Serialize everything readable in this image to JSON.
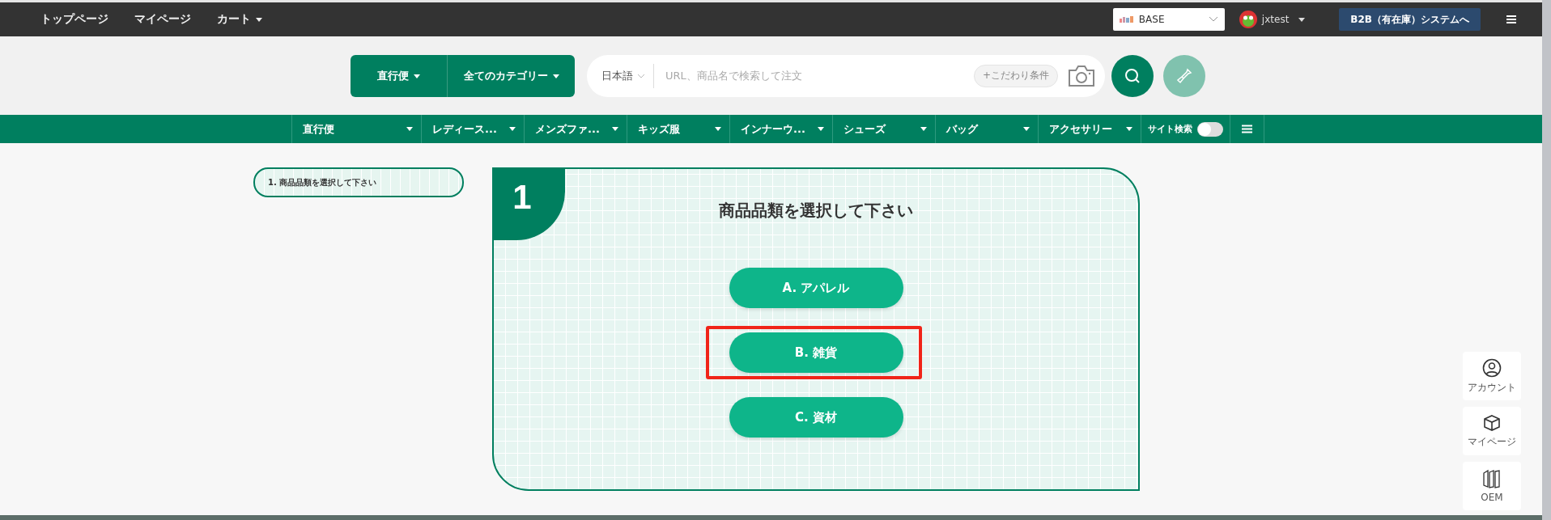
{
  "top_nav": {
    "links": [
      {
        "label": "トップページ",
        "dropdown": false
      },
      {
        "label": "マイページ",
        "dropdown": false
      },
      {
        "label": "カート",
        "dropdown": true
      }
    ],
    "store_select": {
      "value": "BASE"
    },
    "user": {
      "name": "jxtest"
    },
    "system_button": "B2B（有在庫）システムへ"
  },
  "search_bar": {
    "shipping": "直行便",
    "category": "全てのカテゴリー",
    "language": "日本語",
    "placeholder": "URL、商品名で検索して注文",
    "filter": "+こだわり条件"
  },
  "category_nav": {
    "items": [
      {
        "label": "直行便"
      },
      {
        "label": "レディース..."
      },
      {
        "label": "メンズファ..."
      },
      {
        "label": "キッズ服"
      },
      {
        "label": "インナーウ..."
      },
      {
        "label": "シューズ"
      },
      {
        "label": "バッグ"
      },
      {
        "label": "アクセサリー"
      }
    ],
    "site_search": {
      "label": "サイト検索",
      "on": false
    }
  },
  "steps": [
    {
      "label": "1. 商品品類を選択して下さい",
      "selected": true
    }
  ],
  "step_card": {
    "number": "1",
    "title": "商品品類を選択して下さい",
    "options": [
      {
        "label": "A. アパレル",
        "selected": false
      },
      {
        "label": "B. 雑貨",
        "selected": true
      },
      {
        "label": "C. 資材",
        "selected": false
      }
    ]
  },
  "side_buttons": [
    {
      "kind": "account",
      "label": "アカウント"
    },
    {
      "kind": "box",
      "label": "マイページ"
    },
    {
      "kind": "oem",
      "label": "OEM"
    }
  ]
}
